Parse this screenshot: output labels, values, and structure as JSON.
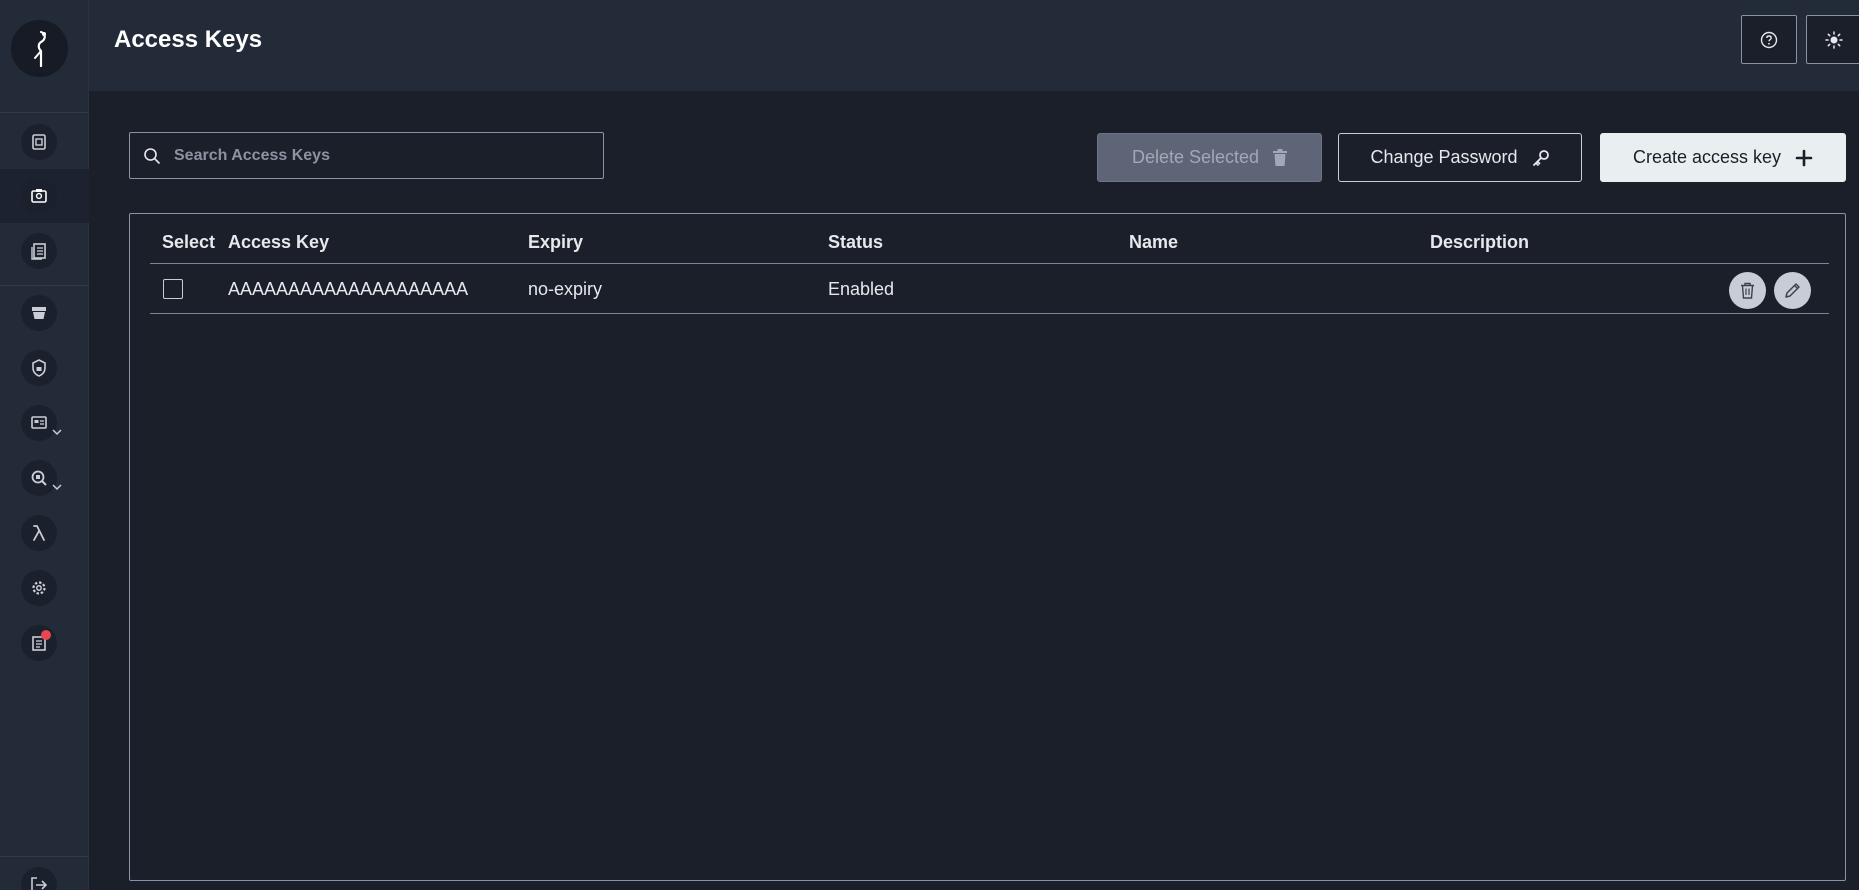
{
  "app": {
    "page_title": "Access Keys"
  },
  "sidebar": {
    "items": [
      {
        "icon": "buckets-icon"
      },
      {
        "icon": "identity-icon",
        "active": true
      },
      {
        "icon": "documents-icon"
      },
      {
        "icon": "tiers-icon"
      },
      {
        "icon": "security-icon"
      },
      {
        "icon": "monitoring-icon",
        "has_submenu": true
      },
      {
        "icon": "metrics-icon",
        "has_submenu": true
      },
      {
        "icon": "lambda-icon"
      },
      {
        "icon": "settings-icon"
      },
      {
        "icon": "license-icon",
        "has_badge": true
      },
      {
        "icon": "logout-icon"
      }
    ]
  },
  "header": {
    "help_icon": "help-icon",
    "theme_icon": "sun-icon"
  },
  "toolbar": {
    "search_placeholder": "Search Access Keys",
    "delete_selected_label": "Delete Selected",
    "change_password_label": "Change Password",
    "create_access_key_label": "Create access key"
  },
  "table": {
    "headers": {
      "select": "Select",
      "access_key": "Access Key",
      "expiry": "Expiry",
      "status": "Status",
      "name": "Name",
      "description": "Description"
    },
    "rows": [
      {
        "access_key": "AAAAAAAAAAAAAAAAAAAA",
        "expiry": "no-expiry",
        "status": "Enabled",
        "name": "",
        "description": ""
      }
    ]
  },
  "colors": {
    "background": "#1a1f2a",
    "sidebar": "#232a38",
    "primary_button": "#e9eef0",
    "disabled_button": "#5d6577",
    "badge": "#e8474f"
  }
}
